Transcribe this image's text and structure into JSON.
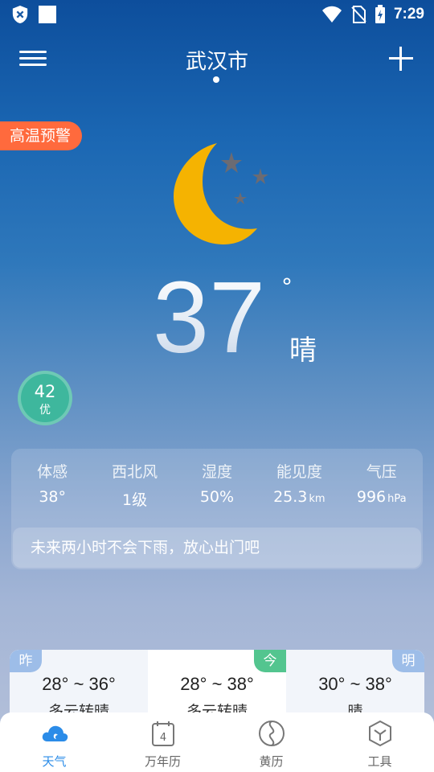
{
  "status_bar": {
    "time": "7:29"
  },
  "header": {
    "city": "武汉市"
  },
  "warning": {
    "label": "高温预警"
  },
  "current": {
    "temperature": "37",
    "degree_symbol": "°",
    "condition": "晴"
  },
  "aqi": {
    "value": "42",
    "level": "优",
    "color": "#3eb79d"
  },
  "details": [
    {
      "label": "体感",
      "value": "38°",
      "unit": ""
    },
    {
      "label": "西北风",
      "value": "1级",
      "unit": ""
    },
    {
      "label": "湿度",
      "value": "50%",
      "unit": ""
    },
    {
      "label": "能见度",
      "value": "25.3",
      "unit": "km"
    },
    {
      "label": "气压",
      "value": "996",
      "unit": "hPa"
    }
  ],
  "rain_tip": "未来两小时不会下雨，放心出门吧",
  "forecast": [
    {
      "tag": "昨",
      "range": "28° ~ 36°",
      "condition": "多云转晴"
    },
    {
      "tag": "今",
      "range": "28° ~ 38°",
      "condition": "多云转晴"
    },
    {
      "tag": "明",
      "range": "30° ~ 38°",
      "condition": "晴"
    }
  ],
  "nav": [
    {
      "label": "天气",
      "icon": "weather-cloud-icon",
      "active": true
    },
    {
      "label": "万年历",
      "icon": "calendar-icon",
      "active": false,
      "badge": "4"
    },
    {
      "label": "黄历",
      "icon": "yin-yang-icon",
      "active": false
    },
    {
      "label": "工具",
      "icon": "toolbox-icon",
      "active": false
    }
  ],
  "colors": {
    "accent": "#2b8ce8",
    "warning": "#ff6a3d",
    "today_tag": "#53c58f",
    "moon": "#f5b301"
  }
}
